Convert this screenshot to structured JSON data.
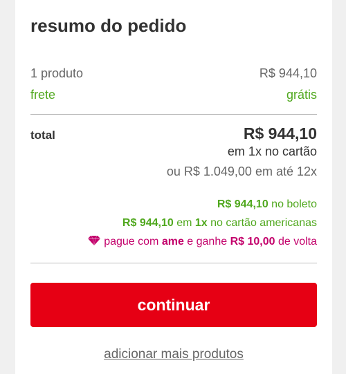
{
  "summary": {
    "title": "resumo do pedido",
    "items_label": "1 produto",
    "items_value": "R$ 944,10",
    "shipping_label": "frete",
    "shipping_value": "grátis",
    "total_label": "total",
    "total_value": "R$ 944,10",
    "total_condition": "em 1x no cartão",
    "installment_option": "ou R$ 1.049,00 em até 12x"
  },
  "promos": {
    "boleto_price": "R$ 944,10",
    "boleto_text": " no boleto",
    "card_price": "R$ 944,10",
    "card_mid": " em ",
    "card_times": "1x",
    "card_text": " no cartão americanas",
    "ame_pre": "pague com ",
    "ame_brand": "ame",
    "ame_mid": " e ganhe ",
    "ame_cashback": "R$ 10,00",
    "ame_post": " de volta",
    "ame_icon": "diamond-heart-icon",
    "ame_color": "#c3006b"
  },
  "actions": {
    "continue_label": "continuar",
    "add_more_label": "adicionar mais produtos"
  },
  "colors": {
    "primary_button": "#e60014",
    "discount_green": "#50a81e"
  }
}
